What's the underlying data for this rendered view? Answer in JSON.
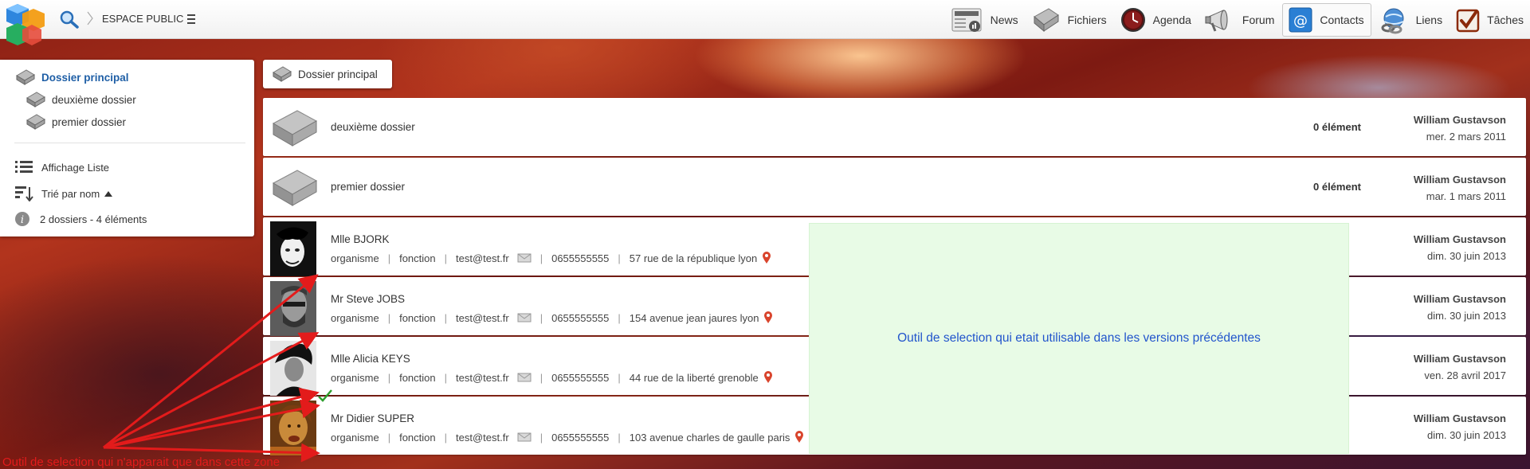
{
  "header": {
    "space_label": "ESPACE PUBLIC",
    "nav": [
      {
        "label": "News",
        "icon": "newspaper-icon"
      },
      {
        "label": "Fichiers",
        "icon": "files-icon"
      },
      {
        "label": "Agenda",
        "icon": "clock-icon"
      },
      {
        "label": "Forum",
        "icon": "megaphone-icon"
      },
      {
        "label": "Contacts",
        "icon": "at-icon",
        "active": true
      },
      {
        "label": "Liens",
        "icon": "globe-link-icon"
      },
      {
        "label": "Tâches",
        "icon": "checkbox-icon"
      }
    ]
  },
  "sidebar": {
    "tree": [
      {
        "label": "Dossier principal",
        "active": true
      },
      {
        "label": "deuxième dossier"
      },
      {
        "label": "premier dossier"
      }
    ],
    "view_mode": "Affichage Liste",
    "sort": "Trié par nom",
    "info": "2 dossiers - 4 éléments"
  },
  "breadcrumb": {
    "current": "Dossier principal"
  },
  "folders": [
    {
      "name": "deuxième dossier",
      "count": "0 élément",
      "author": "William Gustavson",
      "date": "mer. 2 mars 2011"
    },
    {
      "name": "premier dossier",
      "count": "0 élément",
      "author": "William Gustavson",
      "date": "mar. 1 mars 2011"
    }
  ],
  "contacts": [
    {
      "name": "Mlle BJORK",
      "org": "organisme",
      "role": "fonction",
      "email": "test@test.fr",
      "phone": "0655555555",
      "address": "57 rue de la république lyon",
      "author": "William Gustavson",
      "date": "dim. 30 juin 2013"
    },
    {
      "name": "Mr Steve JOBS",
      "org": "organisme",
      "role": "fonction",
      "email": "test@test.fr",
      "phone": "0655555555",
      "address": "154 avenue jean jaures lyon",
      "author": "William Gustavson",
      "date": "dim. 30 juin 2013"
    },
    {
      "name": "Mlle Alicia KEYS",
      "org": "organisme",
      "role": "fonction",
      "email": "test@test.fr",
      "phone": "0655555555",
      "address": "44 rue de la liberté grenoble",
      "author": "William Gustavson",
      "date": "ven. 28 avril 2017"
    },
    {
      "name": "Mr Didier SUPER",
      "org": "organisme",
      "role": "fonction",
      "email": "test@test.fr",
      "phone": "0655555555",
      "address": "103 avenue charles de gaulle paris",
      "author": "William Gustavson",
      "date": "dim. 30 juin 2013"
    }
  ],
  "annotations": {
    "green_note": "Outil de selection qui etait utilisable dans les versions précédentes",
    "red_note": "Outil de selection qui n'apparait que dans cette zone"
  },
  "colors": {
    "link_blue": "#1f5fa6",
    "green_zone": "#e8fbe6",
    "annotation_red": "#e31b1b",
    "annotation_blue": "#2255cc"
  }
}
